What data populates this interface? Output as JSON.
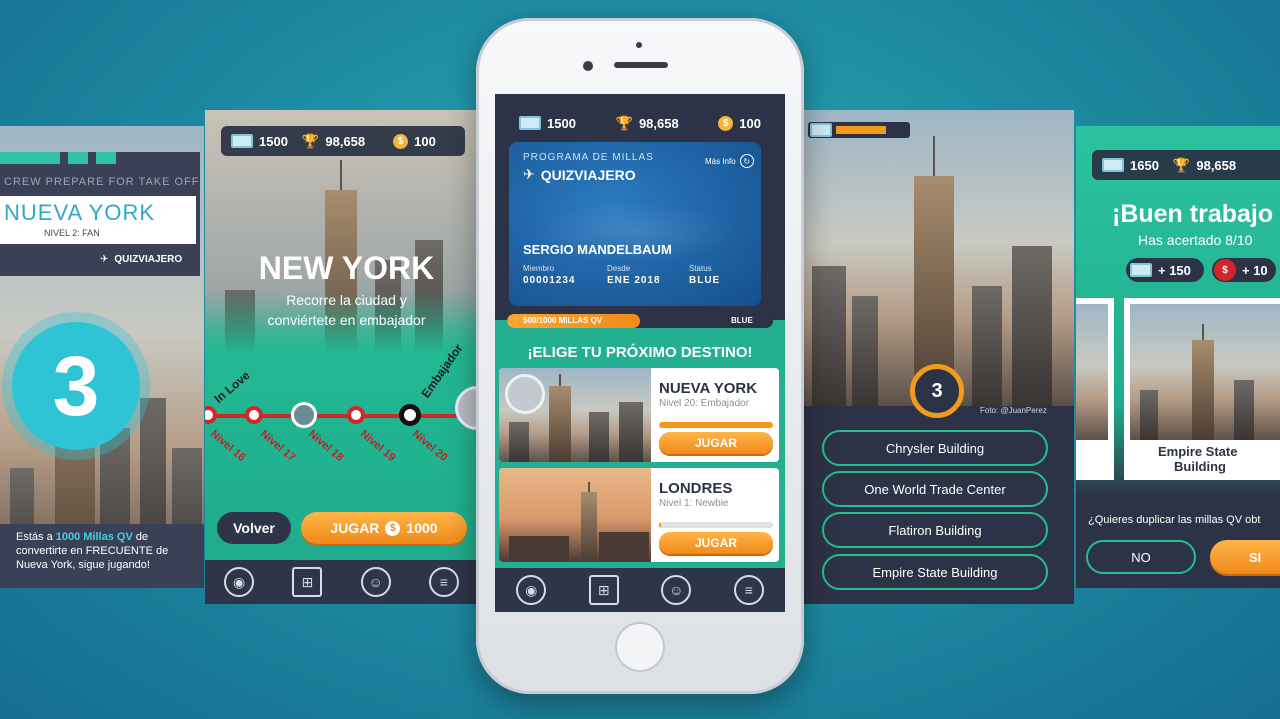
{
  "screen1": {
    "banner": "CREW PREPARE FOR TAKE OFF",
    "city": "NUEVA YORK",
    "level": "NIVEL 2: FAN",
    "brand": "QUIZVIAJERO",
    "countdown": "3",
    "msg_pre": "Estás a ",
    "msg_highlight": "1000 Millas QV",
    "msg_post": " de convertirte en FRECUENTE de Nueva York, sigue jugando!"
  },
  "screen2": {
    "miles": "1500",
    "trophies": "98,658",
    "coins": "100",
    "title": "NEW YORK",
    "subtitle_1": "Recorre la ciudad y",
    "subtitle_2": "conviértete en embajador",
    "track_label_left": "In Love",
    "track_label_right": "Embajador",
    "levels": [
      "Nivel 16",
      "Nivel 17",
      "Nivel 18",
      "Nivel 19",
      "Nivel 20"
    ],
    "back_label": "Volver",
    "play_label": "JUGAR",
    "play_cost": "1000"
  },
  "phone": {
    "miles": "1500",
    "trophies": "98,658",
    "coins": "100",
    "card": {
      "program": "PROGRAMA DE MILLAS",
      "brand": "QUIZVIAJERO",
      "more_info": "Más Info",
      "holder": "SERGIO MANDELBAUM",
      "member_label": "Miembro",
      "member_value": "00001234",
      "since_label": "Desde",
      "since_value": "ENE 2018",
      "status_label": "Status",
      "status_value": "BLUE"
    },
    "progress_label": "500/1000 MILLAS QV",
    "progress_fraction": 0.5,
    "progress_status": "BLUE",
    "heading": "¡ELIGE TU PRÓXIMO DESTINO!",
    "destinations": [
      {
        "name": "NUEVA YORK",
        "level": "Nivel 20: Embajador",
        "progress": 1.0,
        "button": "JUGAR"
      },
      {
        "name": "LONDRES",
        "level": "Nivel 1: Newbie",
        "progress": 0.02,
        "button": "JUGAR"
      }
    ]
  },
  "screen4": {
    "timer": "3",
    "credit": "Foto: @JuanPerez",
    "answers": [
      "Chrysler Building",
      "One World Trade Center",
      "Flatiron Building",
      "Empire State Building"
    ]
  },
  "screen5": {
    "miles": "1650",
    "trophies": "98,658",
    "title": "¡Buen trabajo",
    "subtitle": "Has acertado 8/10",
    "reward_miles": "+ 150",
    "reward_coins": "+ 10",
    "card_label_1": "Empire State",
    "card_label_2": "Building",
    "question": "¿Quieres duplicar las millas QV obt",
    "no_label": "NO",
    "yes_label": "SI"
  },
  "colors": {
    "accent_orange": "#f49a23",
    "teal": "#21c08e",
    "dark_panel": "#2f3548",
    "card_blue": "#1d5f9e"
  }
}
